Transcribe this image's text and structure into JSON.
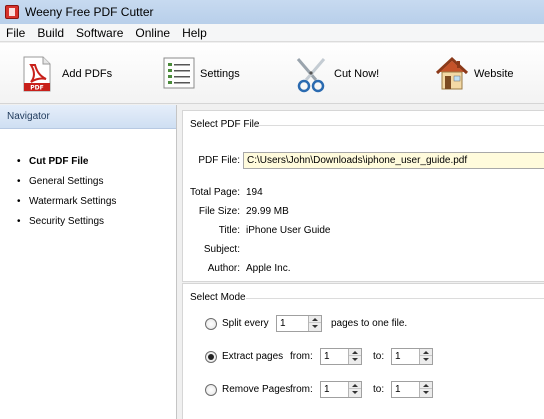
{
  "window": {
    "title": "Weeny Free PDF Cutter",
    "icon": "app-pdf-icon"
  },
  "menu": [
    "File",
    "Build",
    "Software",
    "Online",
    "Help"
  ],
  "toolbar": {
    "add_pdfs": "Add PDFs",
    "settings": "Settings",
    "cut_now": "Cut Now!",
    "website": "Website"
  },
  "navigator": {
    "title": "Navigator",
    "items": [
      {
        "label": "Cut PDF File",
        "active": true
      },
      {
        "label": "General Settings",
        "active": false
      },
      {
        "label": "Watermark Settings",
        "active": false
      },
      {
        "label": "Security Settings",
        "active": false
      }
    ]
  },
  "select_file": {
    "title": "Select PDF File",
    "file_label": "PDF File:",
    "file_value": "C:\\Users\\John\\Downloads\\iphone_user_guide.pdf",
    "info": [
      {
        "label": "Total Page:",
        "value": "194"
      },
      {
        "label": "File Size:",
        "value": "29.99 MB"
      },
      {
        "label": "Title:",
        "value": "iPhone User Guide"
      },
      {
        "label": "Subject:",
        "value": ""
      },
      {
        "label": "Author:",
        "value": "Apple Inc."
      }
    ]
  },
  "select_mode": {
    "title": "Select Mode",
    "split": {
      "label": "Split every",
      "value": "1",
      "suffix": "pages to one file.",
      "selected": false
    },
    "extract": {
      "label": "Extract pages",
      "from_label": "from:",
      "from_value": "1",
      "to_label": "to:",
      "to_value": "1",
      "selected": true
    },
    "remove": {
      "label": "Remove Pages",
      "from_label": "from:",
      "from_value": "1",
      "to_label": "to:",
      "to_value": "1",
      "selected": false
    }
  }
}
